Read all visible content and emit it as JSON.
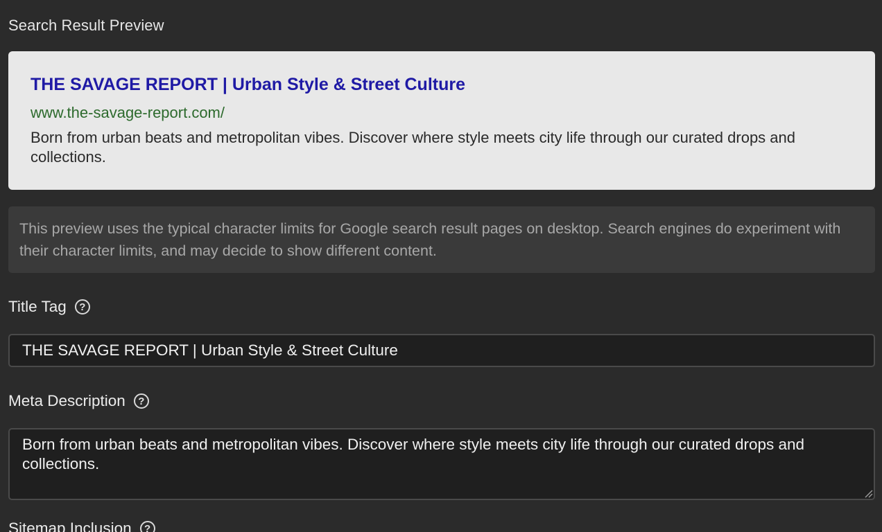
{
  "preview": {
    "heading": "Search Result Preview",
    "serp_title": "THE SAVAGE REPORT | Urban Style & Street Culture",
    "serp_url": "www.the-savage-report.com/",
    "serp_description": "Born from urban beats and metropolitan vibes. Discover where style meets city life through our curated drops and collections."
  },
  "notice": {
    "text": "This preview uses the typical character limits for Google search result pages on desktop. Search engines do experiment with their character limits, and may decide to show different content."
  },
  "title_tag": {
    "label": "Title Tag",
    "help_icon": "?",
    "value": "THE SAVAGE REPORT | Urban Style & Street Culture"
  },
  "meta_description": {
    "label": "Meta Description",
    "help_icon": "?",
    "value": "Born from urban beats and metropolitan vibes. Discover where style meets city life through our curated drops and collections."
  },
  "next_field": {
    "label": "Sitemap Inclusion",
    "help_icon": "?"
  },
  "colors": {
    "background": "#2b2b2b",
    "serp_title": "#1f1aa5",
    "serp_url": "#2d6a2d",
    "serp_card": "#e8e8e8"
  }
}
